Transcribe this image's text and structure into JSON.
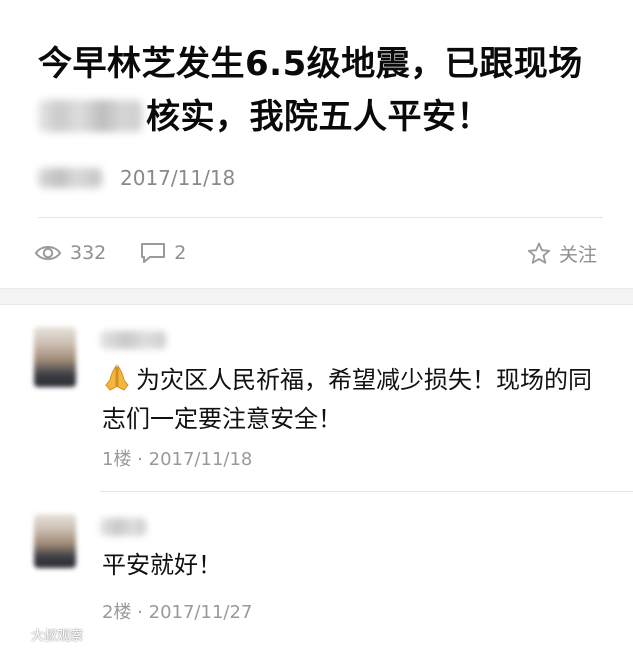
{
  "post": {
    "title_line1": "今早林芝发生6.5级地震，已跟现场",
    "title_line2": "核实，我院五人平安！",
    "date": "2017/11/18",
    "views": "332",
    "comments_count": "2",
    "follow_label": "关注",
    "icons": {
      "views": "eye-icon",
      "comments": "comment-bubble-icon",
      "follow": "star-icon"
    }
  },
  "comments": [
    {
      "text": "为灾区人民祈福，希望减少损失！现场的同志们一定要注意安全！",
      "floor": "1楼",
      "date": "2017/11/18",
      "emoji": "folded-hands-icon"
    },
    {
      "text": "平安就好！",
      "floor": "2楼",
      "date": "2017/11/27"
    }
  ],
  "meta_separator": " · ",
  "watermark": {
    "text": "大叔观察",
    "icon": "weibo-logo-icon"
  },
  "colors": {
    "text": "#111111",
    "muted": "#8a8a8a",
    "divider": "#e6e6e6",
    "band": "#f3f3f4"
  }
}
